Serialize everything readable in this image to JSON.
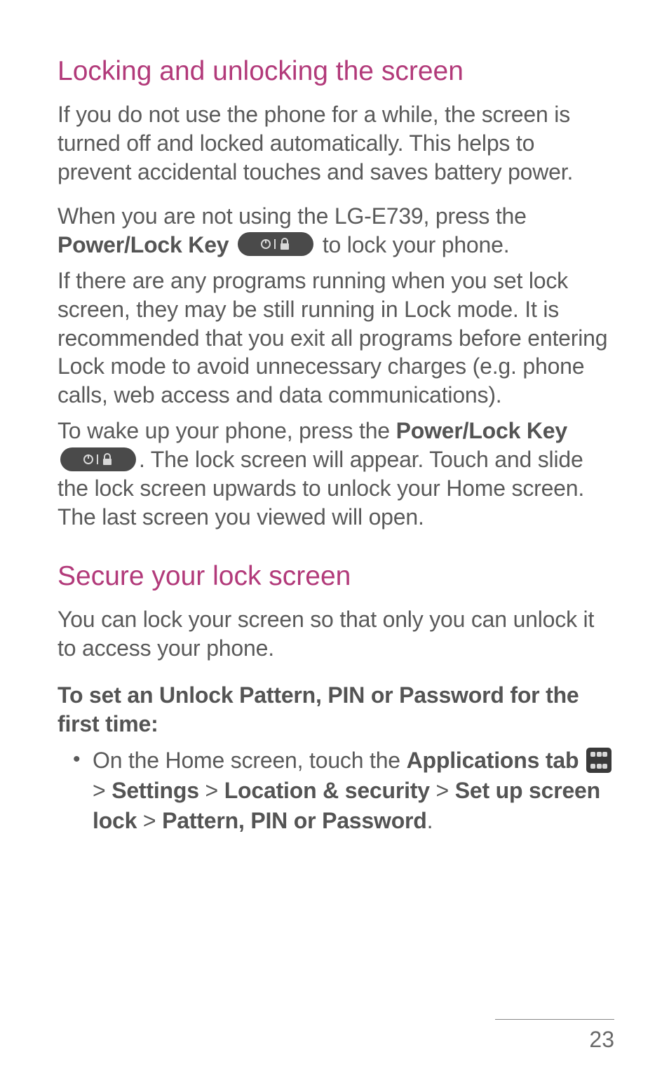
{
  "section1": {
    "title": "Locking and unlocking the screen",
    "p1": "If you do not use the phone for a while, the screen is turned off and locked automatically. This helps to prevent accidental touches and saves battery power.",
    "p2_a": "When you are not using the LG-E739, press the ",
    "p2_key": "Power/Lock Key",
    "p2_b": " to lock your phone.",
    "p3": "If there are any programs running when you set lock screen, they may be still running in Lock mode. It is recommended that you exit all programs before entering Lock mode to avoid unnecessary charges (e.g. phone calls, web access and data communications).",
    "p4_a": "To wake up your phone, press the ",
    "p4_key": "Power/Lock Key",
    "p4_b": ". The lock screen will appear. Touch and slide the lock screen upwards to unlock your Home screen. The last screen you viewed will open."
  },
  "section2": {
    "title": "Secure your lock screen",
    "p1": "You can lock your screen so that only you can unlock it to access your phone.",
    "subhead": "To set an Unlock Pattern, PIN or Password for the first time:",
    "bullet_a": "On the Home screen, touch the ",
    "bullet_apps": "Applications tab",
    "bullet_gt1": " > ",
    "bullet_settings": "Settings",
    "bullet_gt2": " > ",
    "bullet_loc": "Location & security",
    "bullet_gt3": " > ",
    "bullet_setlock": "Set up screen lock",
    "bullet_gt4": " > ",
    "bullet_pattern": "Pattern, PIN or Password",
    "bullet_end": "."
  },
  "page_number": "23"
}
